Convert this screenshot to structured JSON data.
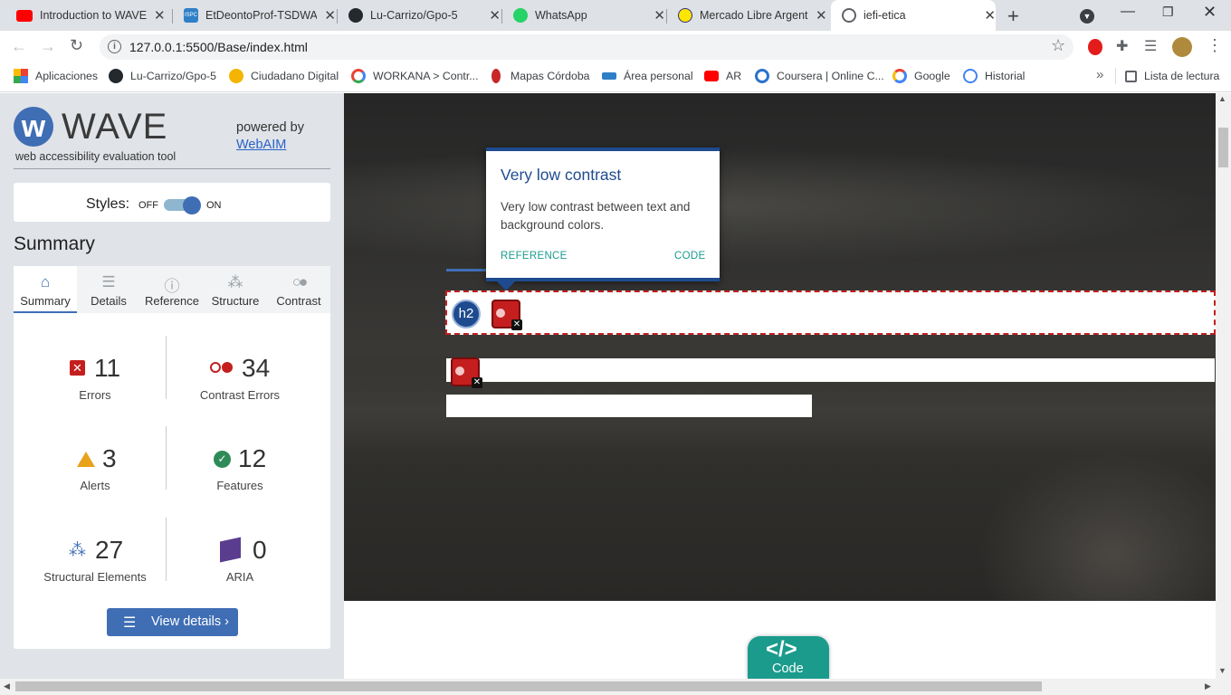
{
  "browser": {
    "tabs": [
      {
        "title": "Introduction to WAVE",
        "icon": "youtube-icon",
        "active": false
      },
      {
        "title": "EtDeontoProf-TSDWAD",
        "icon": "ispc-icon",
        "active": false
      },
      {
        "title": "Lu-Carrizo/Gpo-5",
        "icon": "github-icon",
        "active": false
      },
      {
        "title": "WhatsApp",
        "icon": "whatsapp-icon",
        "active": false
      },
      {
        "title": "Mercado Libre Argentina",
        "icon": "mercadolibre-icon",
        "active": false
      },
      {
        "title": "iefi-etica",
        "icon": "globe-icon",
        "active": true
      }
    ],
    "url": "127.0.0.1:5500/Base/index.html",
    "bookmarks": [
      {
        "label": "Aplicaciones",
        "icon": "apps-grid-icon"
      },
      {
        "label": "Lu-Carrizo/Gpo-5",
        "icon": "github-icon"
      },
      {
        "label": "Ciudadano Digital",
        "icon": "ciudadano-icon"
      },
      {
        "label": "WORKANA > Contr...",
        "icon": "workana-icon"
      },
      {
        "label": "Mapas Córdoba",
        "icon": "maps-icon"
      },
      {
        "label": "Área personal",
        "icon": "ispc-icon"
      },
      {
        "label": "AR",
        "icon": "youtube-icon"
      },
      {
        "label": "Coursera | Online C...",
        "icon": "coursera-icon"
      },
      {
        "label": "Google",
        "icon": "google-icon"
      },
      {
        "label": "Historial",
        "icon": "history-icon"
      }
    ],
    "reading_list": "Lista de lectura",
    "overflow": "»"
  },
  "wave": {
    "logo_text": "WAVE",
    "tagline": "web accessibility evaluation tool",
    "powered_by": "powered by",
    "powered_link": "WebAIM",
    "styles_label": "Styles:",
    "styles_off": "OFF",
    "styles_on": "ON",
    "styles_enabled": true,
    "section_title": "Summary",
    "tabs": [
      {
        "label": "Summary",
        "icon": "home-icon",
        "active": true
      },
      {
        "label": "Details",
        "icon": "list-icon",
        "active": false
      },
      {
        "label": "Reference",
        "icon": "info-icon",
        "active": false
      },
      {
        "label": "Structure",
        "icon": "structure-icon",
        "active": false
      },
      {
        "label": "Contrast",
        "icon": "contrast-icon",
        "active": false
      }
    ],
    "stats": {
      "errors": {
        "count": "11",
        "label": "Errors"
      },
      "contrast_errors": {
        "count": "34",
        "label": "Contrast Errors"
      },
      "alerts": {
        "count": "3",
        "label": "Alerts"
      },
      "features": {
        "count": "12",
        "label": "Features"
      },
      "structural": {
        "count": "27",
        "label": "Structural Elements"
      },
      "aria": {
        "count": "0",
        "label": "ARIA"
      }
    },
    "view_details": "View details ›"
  },
  "page": {
    "popup": {
      "title": "Very low contrast",
      "body": "Very low contrast between text and background colors.",
      "reference": "REFERENCE",
      "code": "CODE"
    },
    "h2_badge": "h2",
    "code_toggle": "Code",
    "code_glyph": "</>"
  },
  "colors": {
    "wave_blue": "#3f6eb5",
    "popup_blue": "#1e4b8f",
    "teal": "#1a9b8c",
    "error_red": "#c41e1e"
  }
}
